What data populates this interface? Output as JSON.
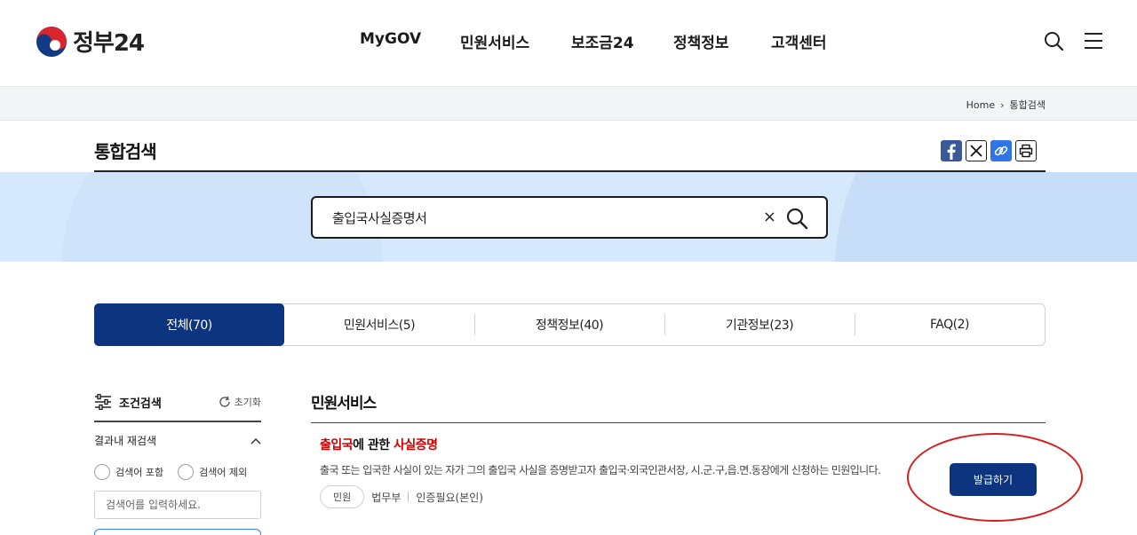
{
  "header": {
    "logo_text": "정부24",
    "nav": [
      "MyGOV",
      "민원서비스",
      "보조금24",
      "정책정보",
      "고객센터"
    ],
    "icons": [
      "search-icon",
      "menu-icon"
    ]
  },
  "breadcrumb": {
    "home": "Home",
    "current": "통합검색"
  },
  "page": {
    "title": "통합검색"
  },
  "share": [
    "facebook-icon",
    "x-icon",
    "link-icon",
    "print-icon"
  ],
  "search": {
    "value": "출입국사실증명서",
    "clear": "×"
  },
  "tabs": [
    {
      "label": "전체(70)",
      "active": true
    },
    {
      "label": "민원서비스(5)"
    },
    {
      "label": "정책정보(40)"
    },
    {
      "label": "기관정보(23)"
    },
    {
      "label": "FAQ(2)"
    }
  ],
  "filter": {
    "title": "조건검색",
    "reset": "초기화",
    "subsection": "결과내 재검색",
    "include": "검색어 포함",
    "exclude": "검색어 제외",
    "placeholder": "검색어를 입력하세요."
  },
  "results": {
    "section_title": "민원서비스",
    "item": {
      "title_hl1": "출입국",
      "title_mid": "에 관한 ",
      "title_hl2": "사실증명",
      "description": "출국 또는 입국한 사실이 있는 자가 그의 출입국 사실을 증명받고자 출입국·외국인관서장, 시.군.구,읍.면.동장에게 신청하는 민원입니다.",
      "chip": "민원",
      "agency": "법무부",
      "auth": "인증필요(본인)",
      "button": "발급하기"
    }
  },
  "colors": {
    "primary": "#0c347f",
    "highlight": "#d10000",
    "annotation": "#d41f1f"
  }
}
